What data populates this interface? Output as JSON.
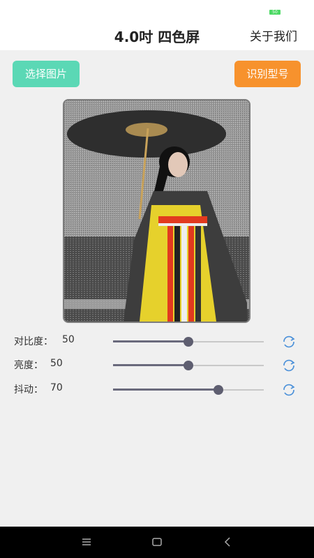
{
  "status": {
    "battery_text": "50"
  },
  "header": {
    "title": "4.0吋 四色屏",
    "about": "关于我们"
  },
  "actions": {
    "select_image": "选择图片",
    "recognize_model": "识别型号"
  },
  "photo": {
    "description_icon": "dithered-photo-preview"
  },
  "sliders": [
    {
      "label": "对比度：",
      "value": "50",
      "fraction": 0.5
    },
    {
      "label": "亮度：",
      "value": "50",
      "fraction": 0.5
    },
    {
      "label": "抖动：",
      "value": "70",
      "fraction": 0.7
    }
  ],
  "colors": {
    "select_button": "#5bd8b5",
    "recognize_button": "#f7922d",
    "slider_thumb": "#5e5e70",
    "reset_icon": "#4a90d9"
  },
  "navbar": {
    "icons": [
      "menu-icon",
      "home-square-icon",
      "back-icon"
    ]
  }
}
